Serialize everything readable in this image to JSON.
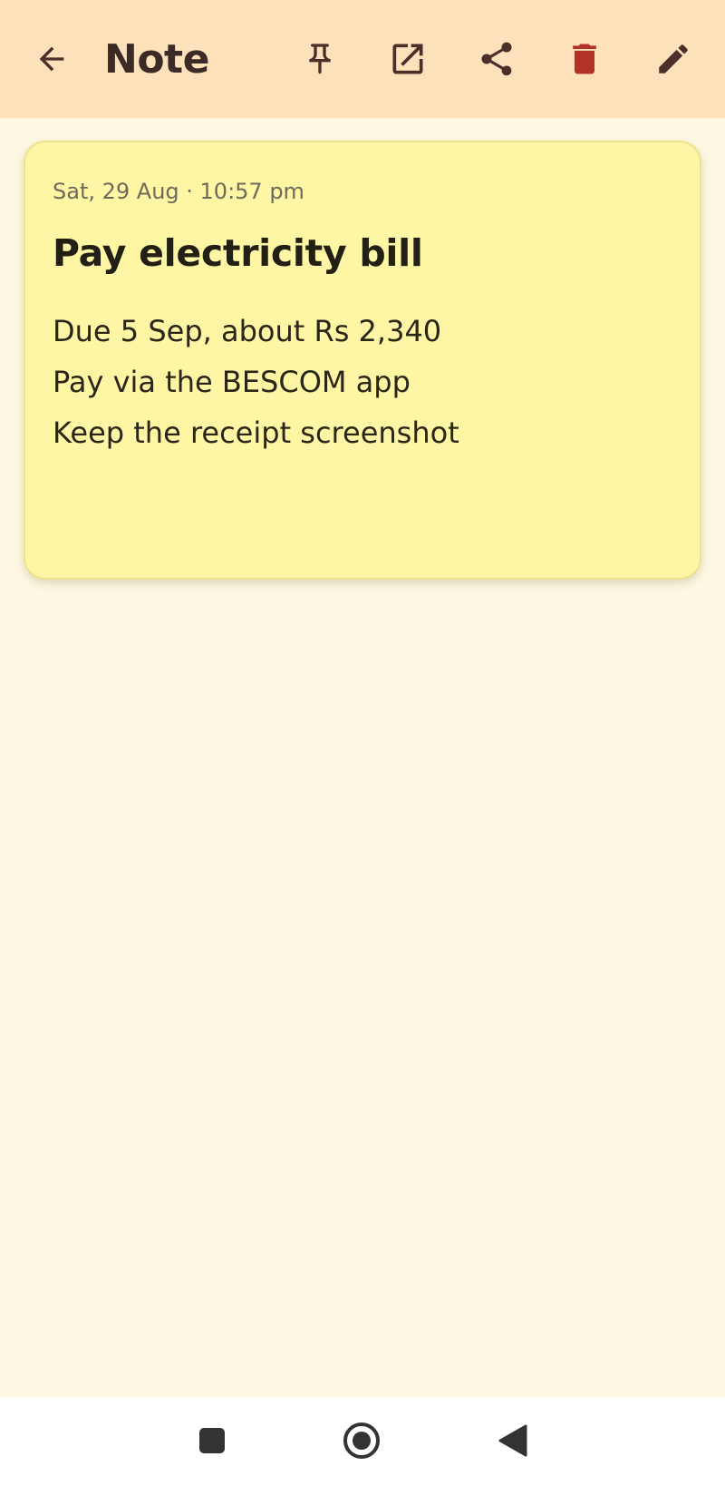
{
  "app_bar": {
    "title": "Note",
    "icons": [
      "arrow-left-icon",
      "pin-icon",
      "open-external-icon",
      "share-icon",
      "trash-icon",
      "pencil-icon"
    ]
  },
  "note": {
    "date": "Sat, 29 Aug · 10:57 pm",
    "title": "Pay electricity bill",
    "lines": [
      "Due 5 Sep, about Rs 2,340",
      "Pay via the BESCOM app",
      "Keep the receipt screenshot"
    ]
  },
  "nav_bar": {
    "icons": [
      "square-recents-icon",
      "circle-home-icon",
      "triangle-back-icon"
    ]
  },
  "colors": {
    "app_bar_bg": "#fce1bb",
    "page_bg": "#fef8e3",
    "card_bg": "#fef5a5",
    "icon_color": "#4a2f2a",
    "delete_color": "#b33228"
  }
}
